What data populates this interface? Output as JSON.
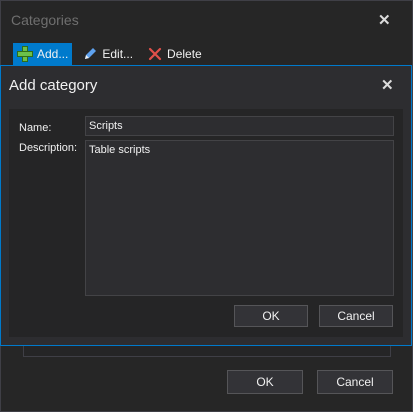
{
  "parent_window": {
    "title": "Categories",
    "close_glyph": "✕",
    "toolbar": {
      "add_label": "Add...",
      "edit_label": "Edit...",
      "delete_label": "Delete"
    },
    "ok_label": "OK",
    "cancel_label": "Cancel"
  },
  "dialog": {
    "title": "Add category",
    "close_glyph": "✕",
    "name_label": "Name:",
    "name_value": "Scripts",
    "description_label": "Description:",
    "description_value": "Table scripts",
    "ok_label": "OK",
    "cancel_label": "Cancel"
  },
  "icons": {
    "add": "plus-icon",
    "edit": "pencil-icon",
    "delete": "delete-icon",
    "close": "close-icon"
  },
  "colors": {
    "accent": "#007acc",
    "add_icon": "#6cc04a",
    "edit_icon": "#5ea2ef",
    "delete_icon": "#e0504a"
  }
}
